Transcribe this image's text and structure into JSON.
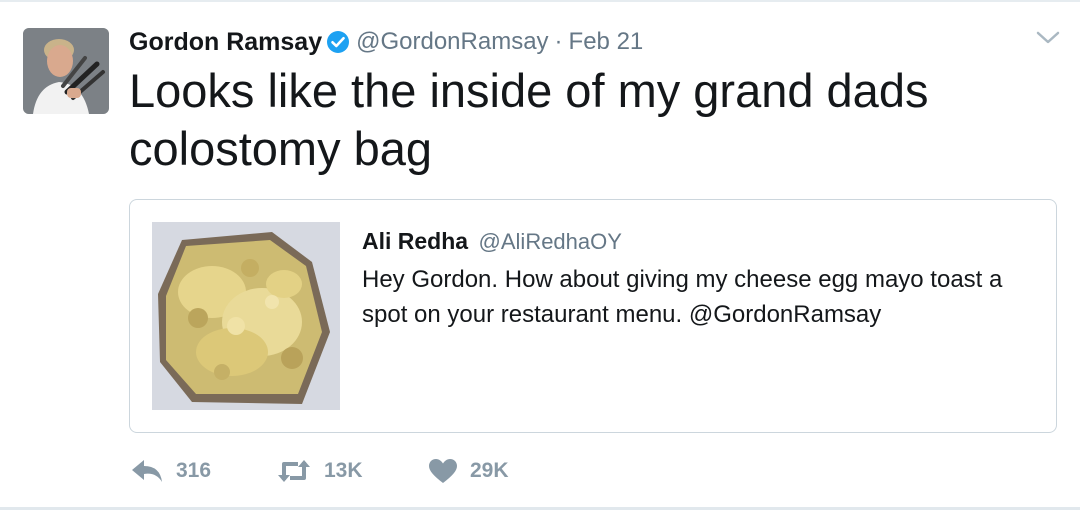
{
  "tweet": {
    "author_name": "Gordon Ramsay",
    "author_handle": "@GordonRamsay",
    "separator": "·",
    "date": "Feb 21",
    "text": "Looks like the inside of my grand dads colostomy bag",
    "verified": true
  },
  "quoted_tweet": {
    "author_name": "Ali Redha",
    "author_handle": "@AliRedhaOY",
    "text": "Hey Gordon. How about giving my cheese egg mayo toast a spot on your restaurant menu. @GordonRamsay"
  },
  "actions": {
    "replies": "316",
    "retweets": "13K",
    "likes": "29K"
  },
  "icons": {
    "avatar": "avatar-photo",
    "verified": "verified-badge-icon",
    "menu": "chevron-down-icon",
    "reply": "reply-icon",
    "retweet": "retweet-icon",
    "like": "heart-icon"
  },
  "colors": {
    "text": "#14171a",
    "secondary": "#657786",
    "action_gray": "#8899a6",
    "verified_blue": "#1da1f2",
    "border": "#ccd6dd"
  }
}
